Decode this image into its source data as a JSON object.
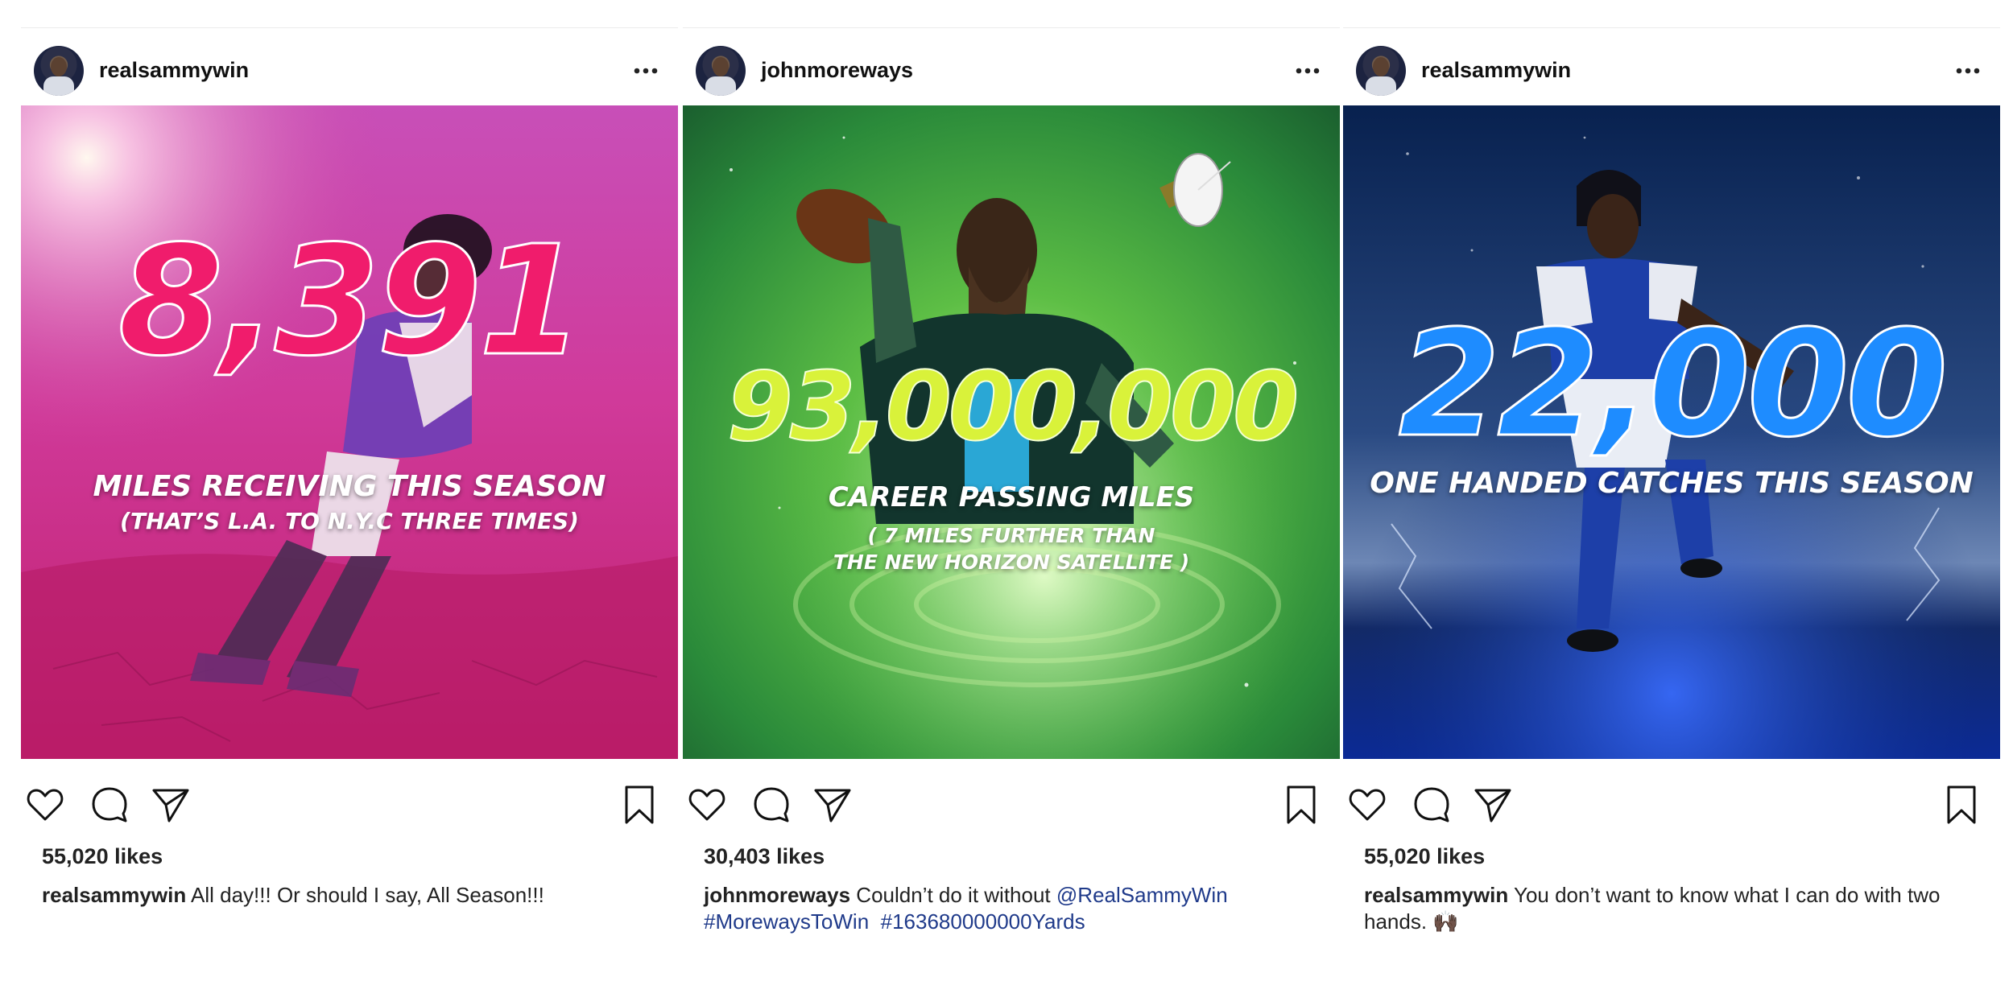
{
  "posts": [
    {
      "username": "realsammywin",
      "stat": "8,391",
      "subtitle_line1": "MILES RECEIVING THIS SEASON",
      "subtitle_line2": "(THAT’S L.A. TO N.Y.C THREE TIMES)",
      "likes": "55,020 likes",
      "caption_user": "realsammywin",
      "caption_text": "All day!!! Or should I say, All Season!!!",
      "caption_mention": "",
      "caption_tags": ""
    },
    {
      "username": "johnmoreways",
      "stat": "93,000,000",
      "subtitle_line1": "CAREER PASSING MILES",
      "subtitle_line2": "( 7 MILES FURTHER THAN",
      "subtitle_line3": "THE NEW HORIZON SATELLITE )",
      "likes": "30,403 likes",
      "caption_user": "johnmoreways",
      "caption_text": "Couldn’t do it without",
      "caption_mention": "@RealSammyWin",
      "caption_tags": "#MorewaysToWin  #163680000000Yards"
    },
    {
      "username": "realsammywin",
      "stat": "22,000",
      "subtitle_line1": "ONE HANDED CATCHES THIS SEASON",
      "likes": "55,020 likes",
      "caption_user": "realsammywin",
      "caption_text": "You don’t want to know what I can do with two hands. 🙌🏿",
      "caption_mention": "",
      "caption_tags": ""
    }
  ],
  "icons": {
    "more": "more-options-icon",
    "like": "heart-icon",
    "comment": "comment-icon",
    "share": "paper-plane-icon",
    "save": "bookmark-icon"
  },
  "colors": {
    "post1_bg": "#d0308f",
    "post1_stat": "#f01c6c",
    "post2_bg": "#3ea83a",
    "post2_stat": "#d9f23a",
    "post3_bg": "#0b2a7a",
    "post3_stat": "#1e8cff",
    "mention": "#1f3a8a"
  }
}
